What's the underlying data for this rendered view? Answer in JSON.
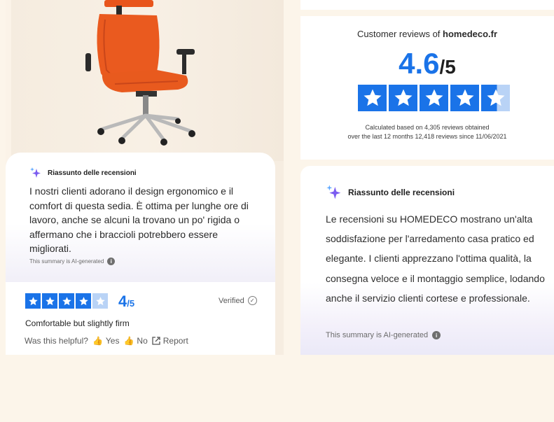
{
  "left": {
    "summary": {
      "title": "Riassunto delle recensioni",
      "text": "I nostri clienti adorano il design ergonomico e il comfort di questa sedia. È ottima per lunghe ore di lavoro, anche se alcuni la trovano un po' rigida o affermano che i braccioli potrebbero essere migliorati.",
      "ai_note": "This summary is AI-generated",
      "icon": "sparkle-icon"
    },
    "review": {
      "rating": 4,
      "rating_value": "4",
      "rating_max": "/5",
      "verified_label": "Verified",
      "title": "Comfortable but slightly firm",
      "helpful_label": "Was this helpful?",
      "yes_label": "Yes",
      "no_label": "No",
      "report_label": "Report"
    }
  },
  "right": {
    "heading_prefix": "Customer reviews of",
    "site": "homedeco.fr",
    "score": "4.6",
    "score_max": "/5",
    "score_fraction": 0.92,
    "calc_line1": "Calculated based on 4,305 reviews obtained",
    "calc_line2": "over the last 12 months 12,418 reviews since 11/06/2021",
    "summary": {
      "title": "Riassunto delle recensioni",
      "text": "Le recensioni su HOMEDECO mostrano un'alta soddisfazione per l'arredamento casa pratico ed elegante. I clienti apprezzano l'ottima qualità, la consegna veloce e il montaggio semplice, lodando anche il servizio clienti cortese e professionale.",
      "ai_note": "This summary is AI-generated"
    }
  },
  "colors": {
    "accent": "#1a73e8",
    "accent_light": "#b9d3f6",
    "background": "#fcf5ea",
    "sparkle": "#7b5cf0"
  }
}
